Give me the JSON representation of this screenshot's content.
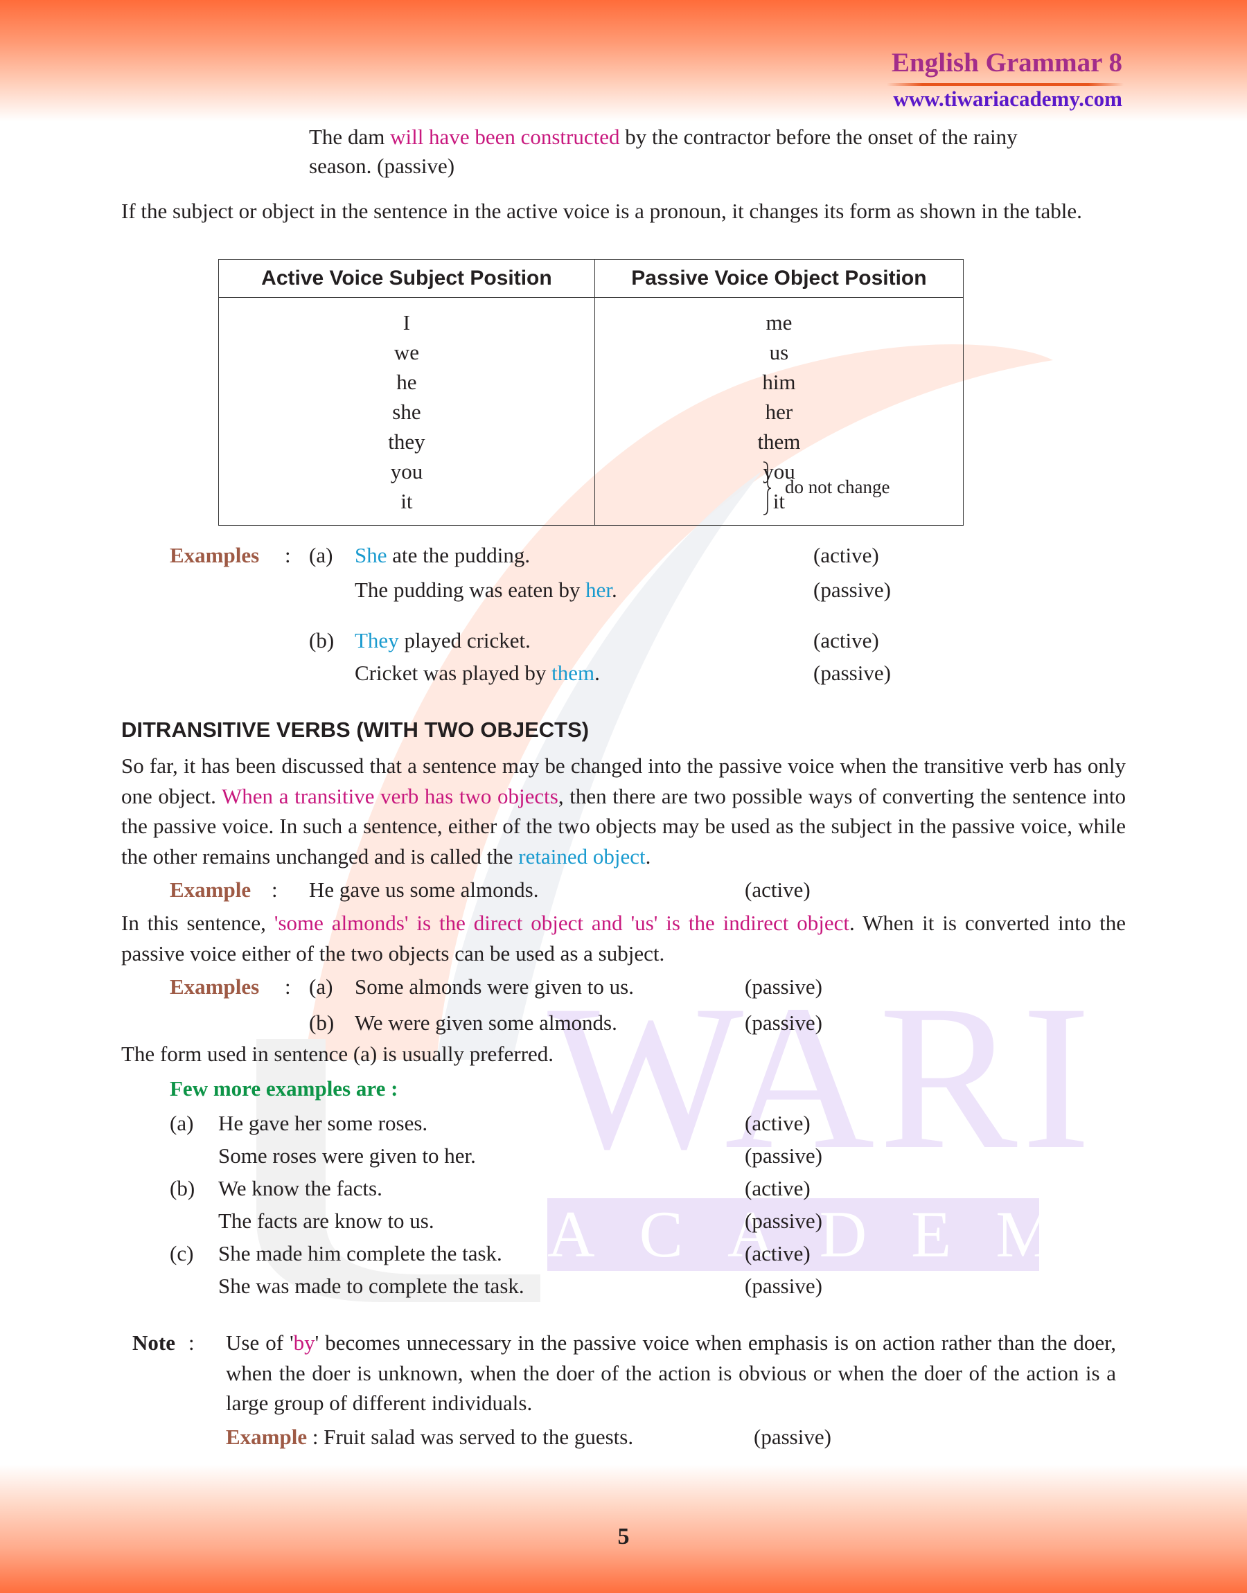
{
  "header": {
    "title": "English Grammar 8",
    "url": "www.tiwariacademy.com"
  },
  "colors": {
    "title": "#a22c8a",
    "url": "#5a18c9",
    "highlight_pink": "#c8187e",
    "highlight_blue": "#1a9bcf",
    "label_brown": "#9e5a45",
    "label_green": "#0d9447",
    "band_orange": "#ff6c3a"
  },
  "watermark": {
    "word": "TIWARI",
    "word_visible": "WARI",
    "sub": "ACADEMY"
  },
  "intro": {
    "dam_pre": "The dam ",
    "dam_highlight": "will have been constructed",
    "dam_post": " by the contractor before the onset of the rainy",
    "dam_line2": "season. (passive)",
    "pronoun_para": "If the subject or object in the sentence in the active voice is a pronoun, it changes its form as shown in the table."
  },
  "table": {
    "headers": [
      "Active Voice Subject Position",
      "Passive Voice Object Position"
    ],
    "active": [
      "I",
      "we",
      "he",
      "she",
      "they",
      "you",
      "it"
    ],
    "passive": [
      "me",
      "us",
      "him",
      "her",
      "them",
      "you",
      "it"
    ],
    "brace_note": "do not change"
  },
  "examples1": {
    "label": "Examples",
    "colon": ":",
    "items": [
      {
        "marker": "(a)",
        "active_hl": "She",
        "active_rest": " ate the pudding.",
        "active_tag": "(active)",
        "passive_pre": "The pudding was eaten by ",
        "passive_hl": "her",
        "passive_post": ".",
        "passive_tag": "(passive)"
      },
      {
        "marker": "(b)",
        "active_hl": "They",
        "active_rest": " played cricket.",
        "active_tag": "(active)",
        "passive_pre": "Cricket was played by ",
        "passive_hl": "them",
        "passive_post": ".",
        "passive_tag": "(passive)"
      }
    ]
  },
  "ditransitive": {
    "heading": "DITRANSITIVE VERBS (WITH TWO OBJECTS)",
    "p1_a": "So far, it has been discussed that a sentence may be changed into the passive voice when the transitive verb has only one object. ",
    "p1_hl": "When a transitive verb has two objects",
    "p1_b": ", then there are two possible ways of converting the sentence into the passive voice. In such a sentence, either of the two objects may be used as the subject in the passive voice, while the other remains unchanged and is called the ",
    "p1_hl2": "retained object",
    "p1_c": ".",
    "example_label": "Example",
    "example_colon": ":",
    "example_text": "He gave us some almonds.",
    "example_tag": "(active)",
    "p2_a": "In this sentence, ",
    "p2_hl": "'some almonds' is the direct object and 'us' is the indirect object",
    "p2_b": ". When it is converted into the passive voice either of the two objects can be used as a subject.",
    "examples_label": "Examples",
    "examples_colon": ":",
    "examples": [
      {
        "marker": "(a)",
        "text": "Some almonds were given to us.",
        "tag": "(passive)"
      },
      {
        "marker": "(b)",
        "text": "We were given some almonds.",
        "tag": "(passive)"
      }
    ],
    "preferred": "The form used in sentence (a) is usually preferred."
  },
  "more_examples": {
    "title": "Few more examples are :",
    "items": [
      {
        "marker": "(a)",
        "active": "He gave her some roses.",
        "active_tag": "(active)",
        "passive": "Some roses were given to her.",
        "passive_tag": "(passive)"
      },
      {
        "marker": "(b)",
        "active": "We know the facts.",
        "active_tag": "(active)",
        "passive": "The facts are know to us.",
        "passive_tag": "(passive)"
      },
      {
        "marker": "(c)",
        "active": "She made him complete the task.",
        "active_tag": "(active)",
        "passive": "She was made to complete the task.",
        "passive_tag": "(passive)"
      }
    ]
  },
  "note": {
    "label": "Note",
    "colon": ":",
    "text_a": "Use of '",
    "text_hl": "by",
    "text_b": "' becomes unnecessary in the passive voice when emphasis is on action rather than the doer, when the doer is unknown, when the doer of the action is obvious or when the doer of the action is a large group of different individuals.",
    "example_label": "Example",
    "example_text": " : Fruit salad was served to the guests.",
    "example_tag": "(passive)"
  },
  "page_number": "5"
}
